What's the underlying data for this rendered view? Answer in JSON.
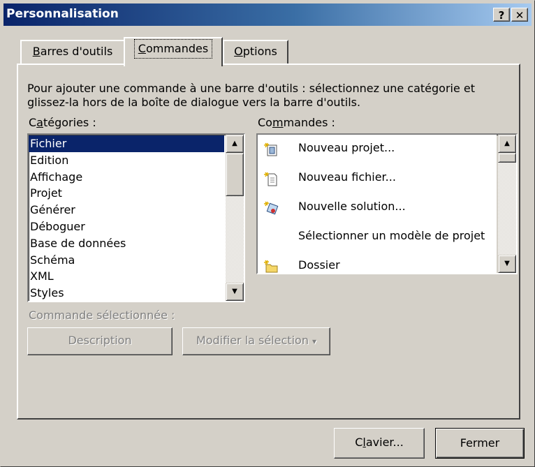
{
  "window": {
    "title": "Personnalisation",
    "help_button": "?",
    "close_button": "✕"
  },
  "tabs": [
    {
      "label_pre": "",
      "label_key": "B",
      "label_post": "arres d'outils",
      "active": false
    },
    {
      "label_pre": "",
      "label_key": "C",
      "label_post": "ommandes",
      "active": true
    },
    {
      "label_pre": "",
      "label_key": "O",
      "label_post": "ptions",
      "active": false
    }
  ],
  "instructions": "Pour ajouter une commande à une barre d'outils : sélectionnez une catégorie et glissez-la hors de la boîte de dialogue vers la barre d'outils.",
  "categories": {
    "label_pre": "C",
    "label_key": "a",
    "label_post": "tégories :",
    "items": [
      "Fichier",
      "Edition",
      "Affichage",
      "Projet",
      "Générer",
      "Déboguer",
      "Base de données",
      "Schéma",
      "XML",
      "Styles"
    ],
    "selected": "Fichier"
  },
  "commands": {
    "label_pre": "Co",
    "label_key": "m",
    "label_post": "mandes :",
    "items": [
      {
        "label": "Nouveau projet...",
        "icon": "new-project-icon"
      },
      {
        "label": "Nouveau fichier...",
        "icon": "new-file-icon"
      },
      {
        "label": "Nouvelle solution...",
        "icon": "new-solution-icon"
      },
      {
        "label": "Sélectionner un modèle de projet",
        "icon": ""
      },
      {
        "label": "Dossier",
        "icon": "new-folder-icon"
      }
    ]
  },
  "selected_command": {
    "label": "Commande sélectionnée :",
    "description_button": "Description",
    "modify_button": "Modifier la sélection",
    "modify_arrow": "▾"
  },
  "footer": {
    "keyboard_pre": "C",
    "keyboard_key": "l",
    "keyboard_post": "avier...",
    "close_button": "Fermer"
  },
  "colors": {
    "selection": "#0a246a",
    "face": "#d4d0c8",
    "titlebar_start": "#0a246a",
    "titlebar_end": "#a6caf0"
  }
}
